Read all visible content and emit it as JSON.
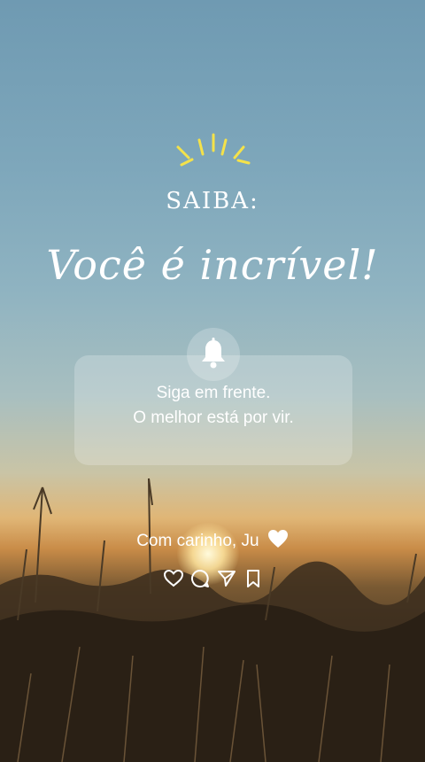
{
  "header": {
    "kicker": "SAIBA:",
    "headline": "Você é incrível!"
  },
  "notification": {
    "line1": "Siga em frente.",
    "line2": "O melhor está por vir."
  },
  "signature": {
    "text": "Com carinho, Ju"
  },
  "icons": {
    "rays": "sun-rays-icon",
    "bell": "bell-icon",
    "signature_emoji": "white-heart-icon",
    "actions": [
      "heart-icon",
      "comment-icon",
      "send-icon",
      "bookmark-icon"
    ]
  },
  "colors": {
    "rays": "#f4e24a",
    "text": "#ffffff"
  }
}
